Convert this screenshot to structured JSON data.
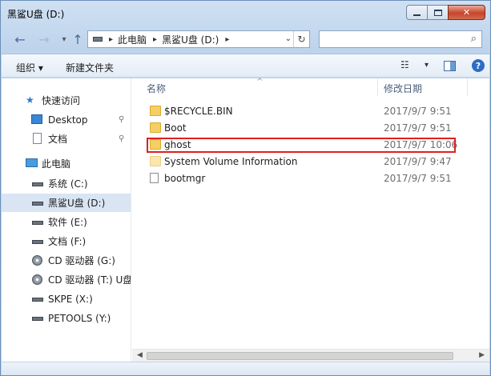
{
  "window": {
    "title": "黑鲨U盘 (D:)",
    "caption": {
      "minimize": "",
      "maximize": "",
      "close": "✕"
    }
  },
  "address": {
    "crumbs": [
      "此电脑",
      "黑鲨U盘 (D:)"
    ],
    "search_placeholder": ""
  },
  "toolbar": {
    "organize": "组织 ▾",
    "new_folder": "新建文件夹",
    "help": "?"
  },
  "nav": {
    "quick_access": "快速访问",
    "desktop": "Desktop",
    "documents": "文档",
    "this_pc": "此电脑",
    "drives": [
      "系统 (C:)",
      "黑鲨U盘 (D:)",
      "软件 (E:)",
      "文档 (F:)",
      "CD 驱动器 (G:)",
      "CD 驱动器 (T:) U盘",
      "SKPE (X:)",
      "PETOOLS (Y:)"
    ],
    "selected_drive_index": 1
  },
  "columns": {
    "name": "名称",
    "modified": "修改日期"
  },
  "files": [
    {
      "name": "$RECYCLE.BIN",
      "date": "2017/9/7 9:51",
      "icon": "folder-icon"
    },
    {
      "name": "Boot",
      "date": "2017/9/7 9:51",
      "icon": "folder-icon"
    },
    {
      "name": "ghost",
      "date": "2017/9/7 10:06",
      "icon": "folder-icon",
      "highlighted": true
    },
    {
      "name": "System Volume Information",
      "date": "2017/9/7 9:47",
      "icon": "folder-icon"
    },
    {
      "name": "bootmgr",
      "date": "2017/9/7 9:51",
      "icon": "file-icon"
    }
  ],
  "colors": {
    "highlight": "#e02020",
    "selection": "#d9e5f3"
  }
}
